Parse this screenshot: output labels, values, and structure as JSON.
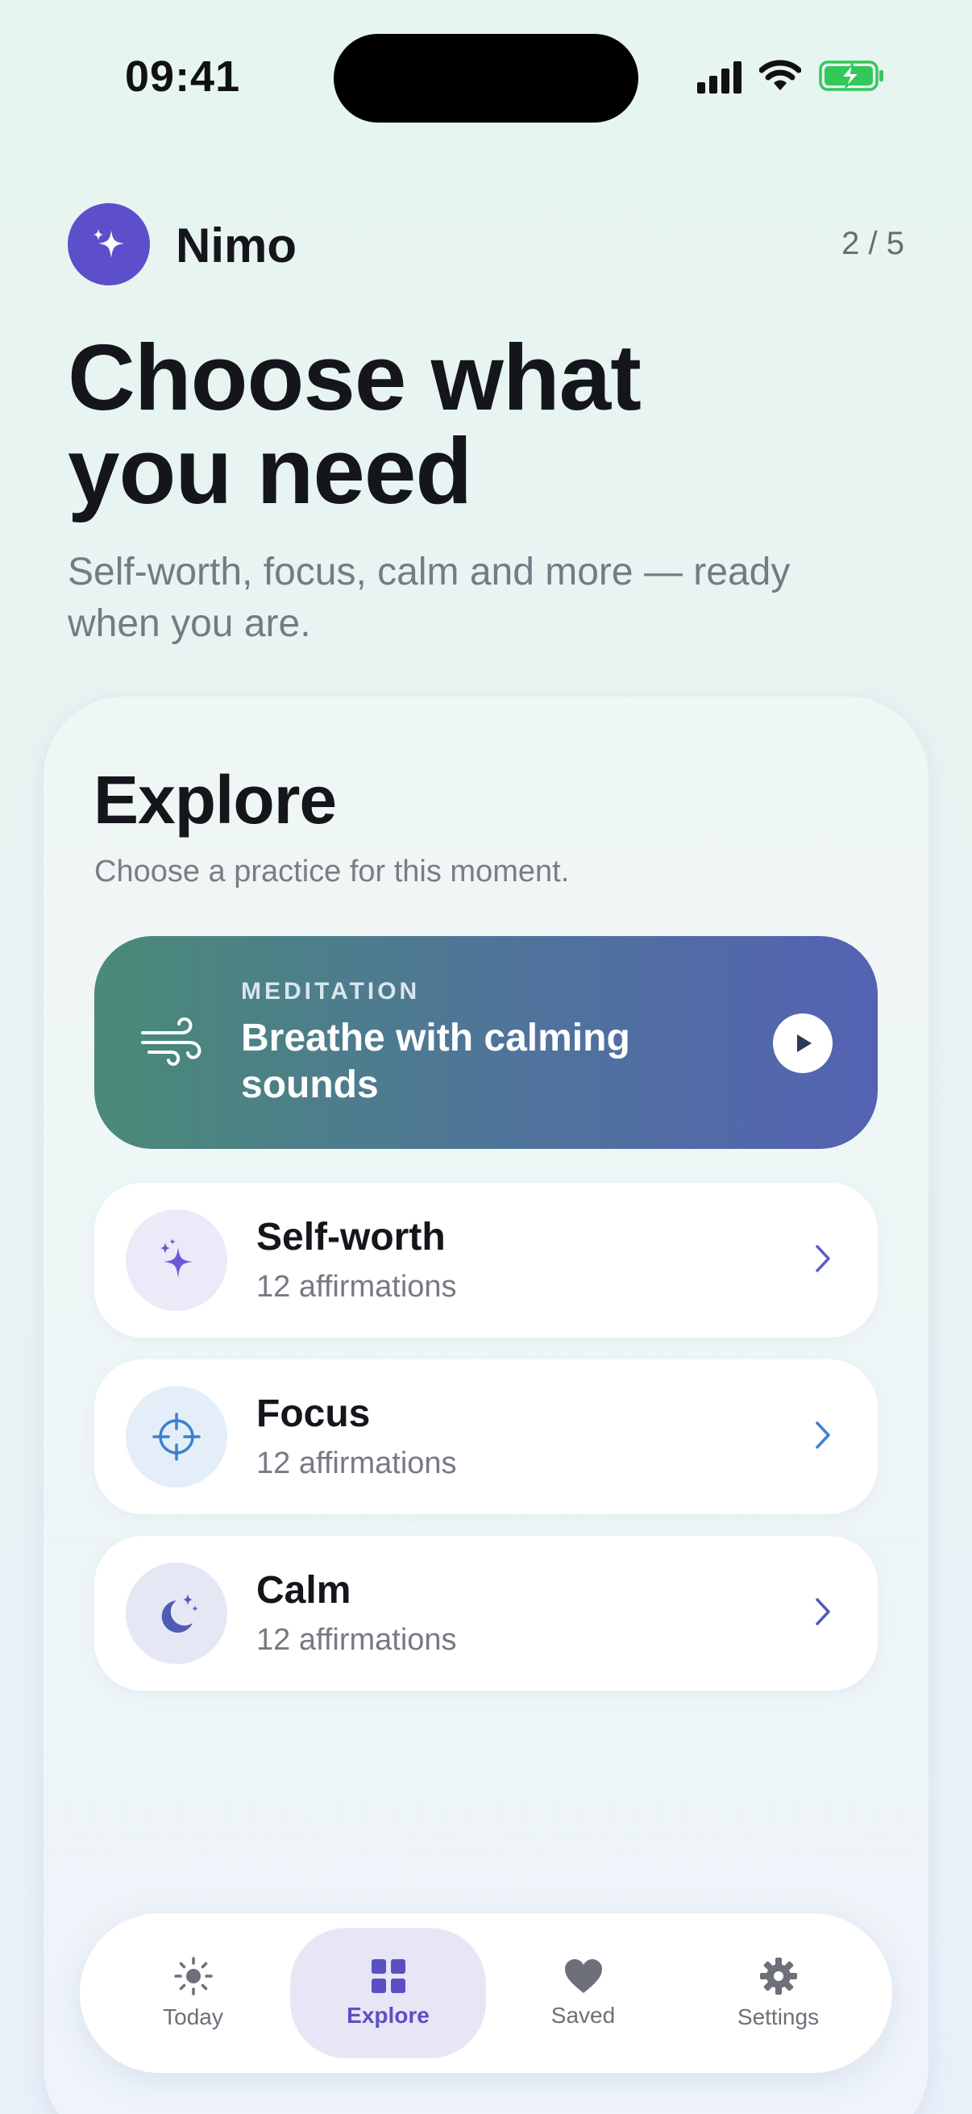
{
  "status_bar": {
    "time": "09:41",
    "icons": [
      "signal-icon",
      "wifi-icon",
      "battery-charging-icon"
    ]
  },
  "header": {
    "app_name": "Nimo",
    "step": "2 / 5",
    "logo_icon": "sparkles-icon"
  },
  "onboarding": {
    "headline_line1": "Choose what",
    "headline_line2": "you need",
    "subhead": "Self-worth, focus, calm and more — ready when you are."
  },
  "explore": {
    "title": "Explore",
    "subtitle": "Choose a practice for this moment.",
    "featured": {
      "label": "MEDITATION",
      "title": "Breathe with calming sounds",
      "icon": "wind-icon",
      "action_icon": "play-icon",
      "gradient": [
        "#4a8a77",
        "#5462b3"
      ]
    },
    "categories": [
      {
        "title": "Self-worth",
        "count": "12 affirmations",
        "icon": "sparkles-icon",
        "icon_bg": "#ece9f8",
        "icon_color": "#6a5ad6"
      },
      {
        "title": "Focus",
        "count": "12 affirmations",
        "icon": "crosshair-icon",
        "icon_bg": "#e3eef9",
        "icon_color": "#3d7fd0"
      },
      {
        "title": "Calm",
        "count": "12 affirmations",
        "icon": "moon-stars-icon",
        "icon_bg": "#e6e7f5",
        "icon_color": "#4f5bb7"
      }
    ]
  },
  "tabbar": {
    "active": "Explore",
    "tabs": [
      {
        "label": "Today",
        "icon": "sun-icon"
      },
      {
        "label": "Explore",
        "icon": "grid-icon"
      },
      {
        "label": "Saved",
        "icon": "heart-icon"
      },
      {
        "label": "Settings",
        "icon": "gear-icon"
      }
    ]
  },
  "colors": {
    "accent": "#5c4fc9",
    "text": "#15151c",
    "muted": "#777a85"
  }
}
